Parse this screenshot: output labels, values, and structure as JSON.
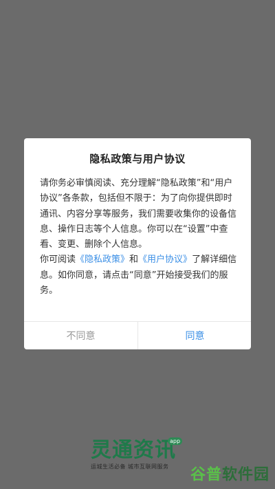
{
  "dialog": {
    "title": "隐私政策与用户协议",
    "body_part1": "请你务必审慎阅读、充分理解“隐私政策”和“用户协议”各条款，包括但不限于：为了向你提供即时通讯、内容分享等服务，我们需要收集你的设备信息、操作日志等个人信息。你可以在“设置”中查看、变更、删除个人信息。",
    "body_part2_prefix": "你可阅读",
    "privacy_link": "《隐私政策》",
    "and_text": "和",
    "agreement_link": "《用户协议》",
    "body_part2_suffix": "了解详细信息。如你同意，请点击“同意”开始接受我们的服务。",
    "disagree_label": "不同意",
    "agree_label": "同意"
  },
  "brand": {
    "name": "灵通资讯",
    "badge": "app",
    "tagline": "运城生活必备 城市互联网服务"
  },
  "watermark": {
    "part1": "谷普",
    "part2": "软件园"
  },
  "colors": {
    "overlay": "#6b6b6b",
    "link": "#3b8fe6",
    "brand_green": "#1f7a4a"
  }
}
